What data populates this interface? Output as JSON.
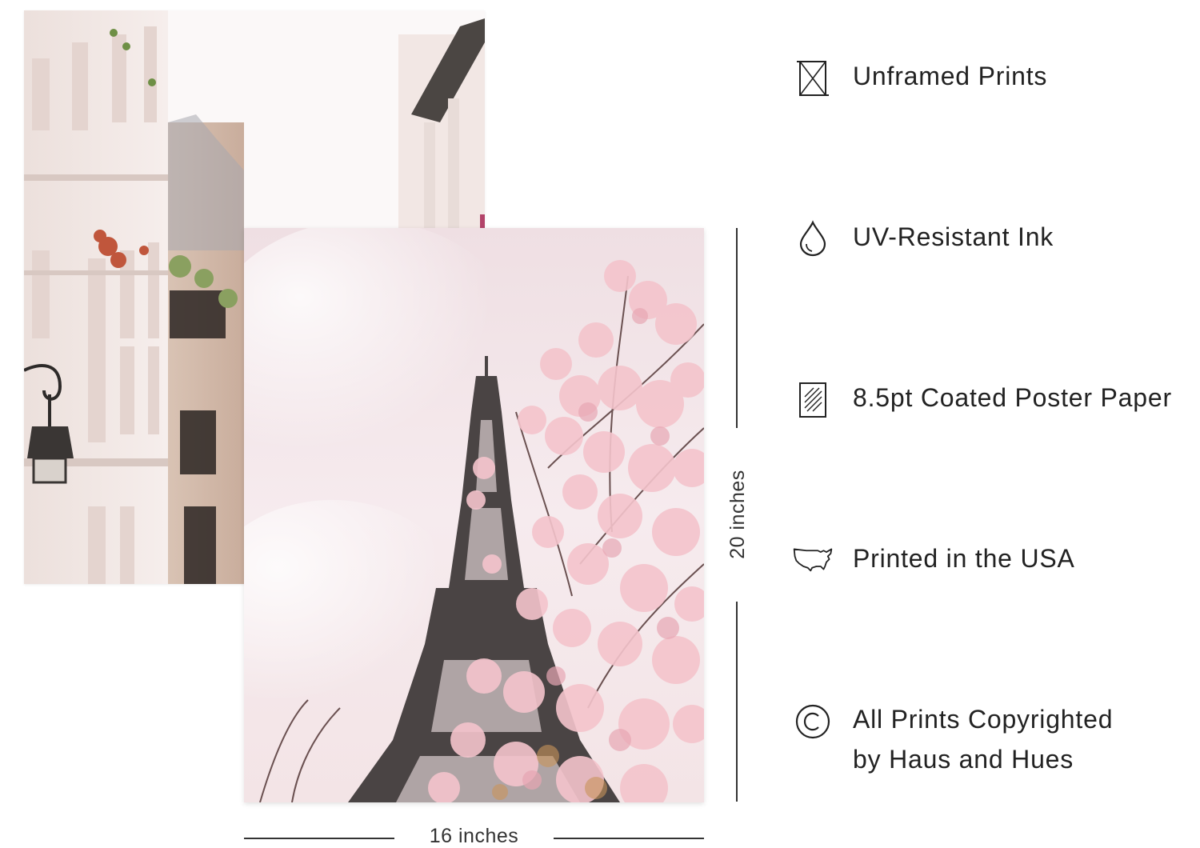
{
  "prints": {
    "back": {
      "subject": "paris-street-photo"
    },
    "front": {
      "subject": "eiffel-tower-cherry-blossom-photo"
    }
  },
  "dimensions": {
    "height_label": "20 inches",
    "width_label": "16 inches"
  },
  "features": [
    {
      "icon": "unframed-icon",
      "label": "Unframed Prints"
    },
    {
      "icon": "ink-drop-icon",
      "label": "UV-Resistant Ink"
    },
    {
      "icon": "paper-icon",
      "label": "8.5pt Coated Poster Paper"
    },
    {
      "icon": "usa-map-icon",
      "label": "Printed in the USA"
    },
    {
      "icon": "copyright-icon",
      "label": "All Prints Copyrighted",
      "label_line2": "by Haus and Hues"
    }
  ]
}
